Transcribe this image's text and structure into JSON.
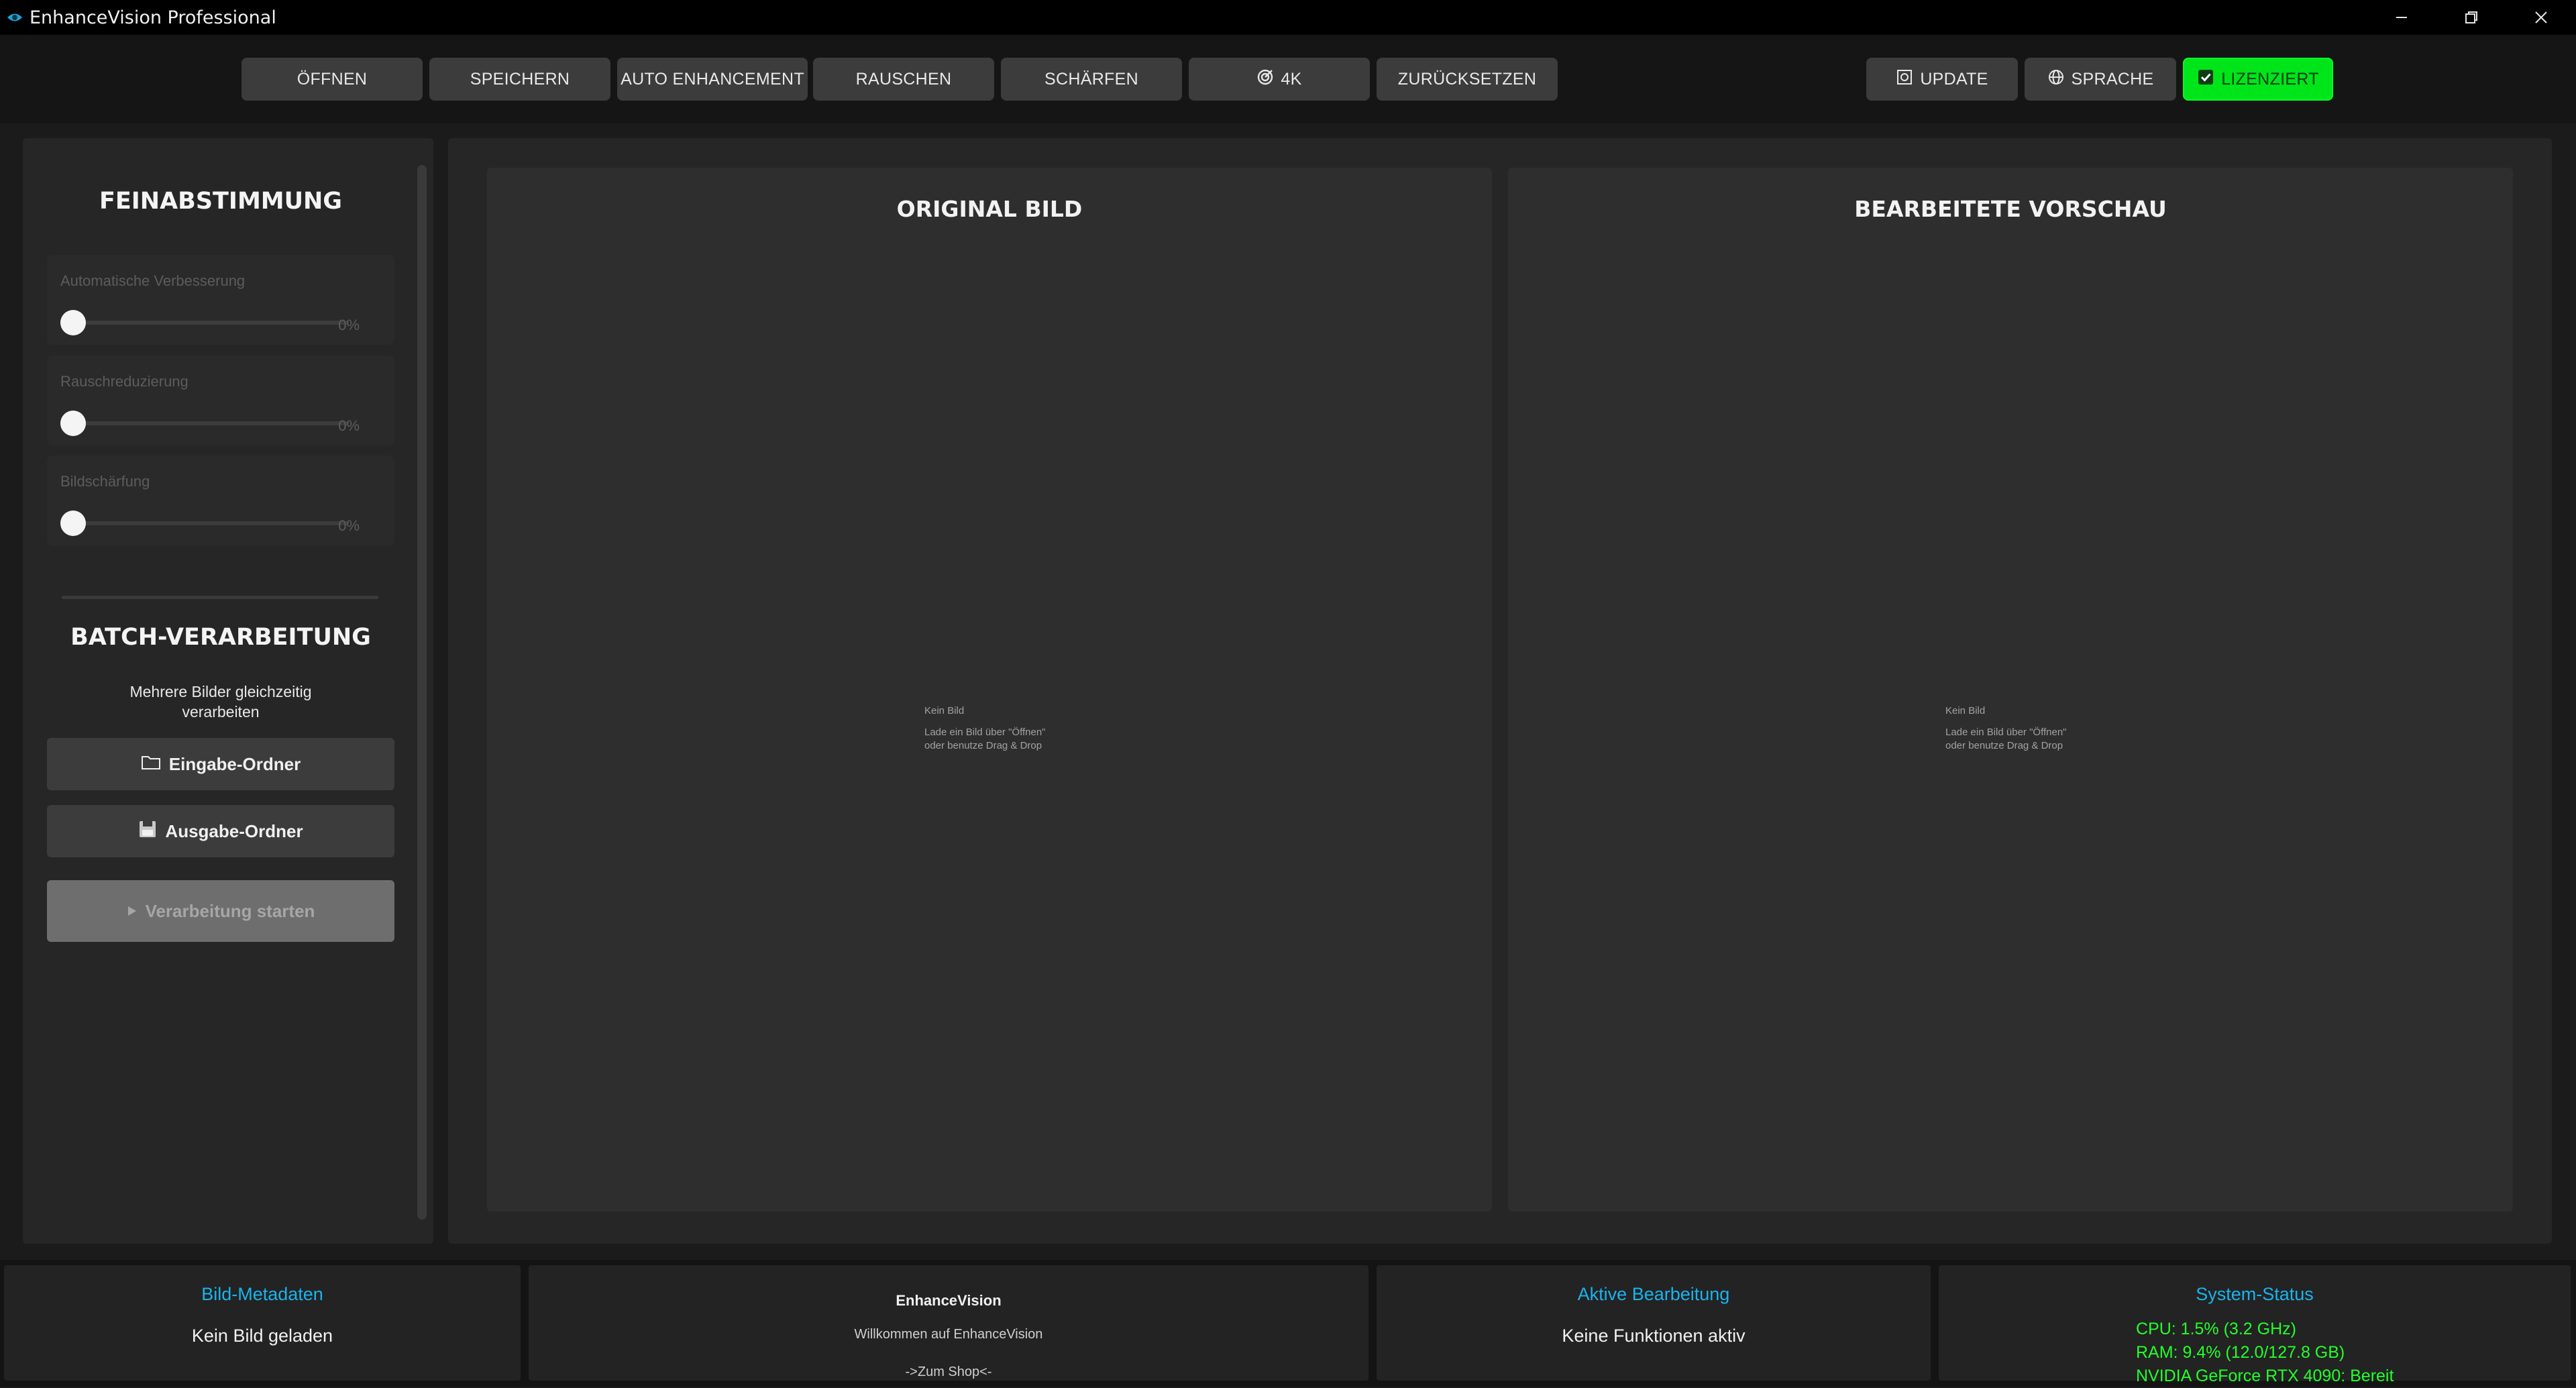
{
  "window": {
    "title": "EnhanceVision Professional",
    "controls": [
      "minimize-icon",
      "restore-icon",
      "close-icon"
    ]
  },
  "toolbar": {
    "buttons": [
      {
        "label": "ÖFFNEN"
      },
      {
        "label": "SPEICHERN"
      },
      {
        "label": "AUTO ENHANCEMENT"
      },
      {
        "label": "RAUSCHEN"
      },
      {
        "label": "SCHÄRFEN"
      },
      {
        "label": "4K",
        "icon": "target-icon"
      },
      {
        "label": "ZURÜCKSETZEN"
      }
    ],
    "right_buttons": [
      {
        "label": "UPDATE",
        "icon": "update-icon"
      },
      {
        "label": "SPRACHE",
        "icon": "globe-icon"
      },
      {
        "label": "LIZENZIERT",
        "icon": "check-icon",
        "color": "#00e51a"
      }
    ]
  },
  "sidebar": {
    "fine_tuning_title": "FEINABSTIMMUNG",
    "sliders": [
      {
        "label": "Automatische Verbesserung",
        "value": "0%",
        "level": 0
      },
      {
        "label": "Rauschreduzierung",
        "value": "0%",
        "level": 0
      },
      {
        "label": "Bildschärfung",
        "value": "0%",
        "level": 0
      }
    ],
    "batch_title": "BATCH-VERARBEITUNG",
    "batch_desc_line1": "Mehrere Bilder gleichzeitig",
    "batch_desc_line2": "verarbeiten",
    "input_folder": "Eingabe-Ordner",
    "output_folder": "Ausgabe-Ordner",
    "start": "Verarbeitung starten"
  },
  "panels": {
    "original_title": "ORIGINAL BILD",
    "preview_title": "BEARBEITETE VORSCHAU",
    "empty_title": "Kein Bild",
    "empty_hint_line1": "Lade ein Bild über \"Öffnen\"",
    "empty_hint_line2": "oder benutze Drag & Drop"
  },
  "footer": {
    "metadata_title": "Bild-Metadaten",
    "metadata_value": "Kein Bild geladen",
    "app_name": "EnhanceVision",
    "welcome": "Willkommen auf EnhanceVision",
    "shop_link": "->Zum Shop<-",
    "active_title": "Aktive Bearbeitung",
    "active_value": "Keine Funktionen aktiv",
    "system_title": "System-Status",
    "cpu": "CPU: 1.5% (3.2 GHz)",
    "ram": "RAM: 9.4% (12.0/127.8 GB)",
    "gpu": "NVIDIA GeForce RTX 4090: Bereit"
  },
  "colors": {
    "accent_green": "#00e51a",
    "accent_blue": "#1ab3ee",
    "status_green": "#22ff2a"
  }
}
